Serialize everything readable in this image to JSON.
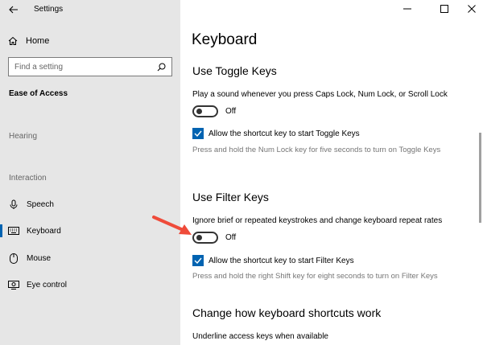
{
  "app": {
    "title": "Settings"
  },
  "icons": {
    "back": "back-arrow-icon",
    "home": "home-icon",
    "search": "search-icon",
    "speech": "microphone-icon",
    "keyboard": "keyboard-icon",
    "mouse": "mouse-icon",
    "eye_control": "eye-control-icon",
    "minimize": "minimize-icon",
    "maximize": "maximize-icon",
    "close": "close-icon",
    "check": "check-icon"
  },
  "sidebar": {
    "home_label": "Home",
    "search_placeholder": "Find a setting",
    "section_heading": "Ease of Access",
    "groups": {
      "hearing": "Hearing",
      "interaction": "Interaction"
    },
    "items": [
      {
        "label": "Speech"
      },
      {
        "label": "Keyboard",
        "active": true
      },
      {
        "label": "Mouse"
      },
      {
        "label": "Eye control"
      }
    ]
  },
  "main": {
    "page_title": "Keyboard",
    "toggle_keys": {
      "heading": "Use Toggle Keys",
      "description": "Play a sound whenever you press Caps Lock, Num Lock, or Scroll Lock",
      "toggle_state": "Off",
      "shortcut_label": "Allow the shortcut key to start Toggle Keys",
      "shortcut_checked": true,
      "hint": "Press and hold the Num Lock key for five seconds to turn on Toggle Keys"
    },
    "filter_keys": {
      "heading": "Use Filter Keys",
      "description": "Ignore brief or repeated keystrokes and change keyboard repeat rates",
      "toggle_state": "Off",
      "shortcut_label": "Allow the shortcut key to start Filter Keys",
      "shortcut_checked": true,
      "hint": "Press and hold the right Shift key for eight seconds to turn on Filter Keys"
    },
    "shortcuts": {
      "heading": "Change how keyboard shortcuts work",
      "underline_label": "Underline access keys when available"
    }
  },
  "colors": {
    "accent": "#0063b1",
    "sidebar_bg": "#e6e6e6",
    "annotation_arrow": "#ef4b3a"
  }
}
